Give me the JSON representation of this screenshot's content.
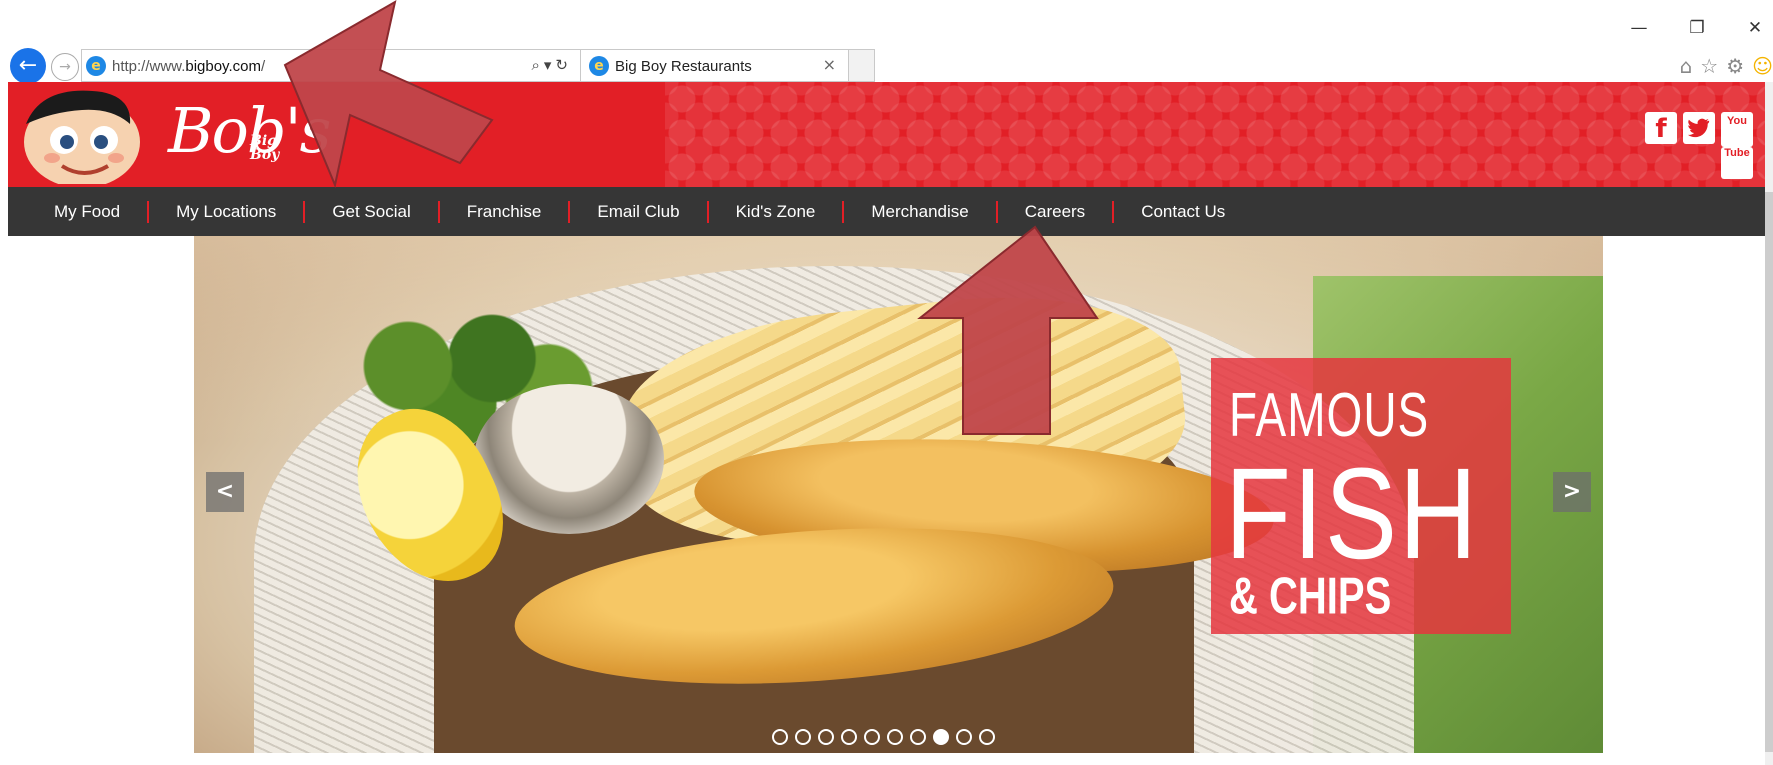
{
  "browser": {
    "window_controls": {
      "minimize": "—",
      "restore": "❐",
      "close": "✕"
    },
    "back_icon": "back-arrow-icon",
    "forward_icon": "forward-arrow-icon",
    "address": {
      "prefix": "http://www.",
      "domain": "bigboy.com",
      "suffix": "/"
    },
    "tab": {
      "title": "Big Boy Restaurants",
      "close": "×"
    },
    "toolbar_icons": [
      "home-icon",
      "favorites-star-icon",
      "settings-gear-icon",
      "smiley-feedback-icon"
    ]
  },
  "header": {
    "logo_main": "Bob's",
    "logo_sub_1": "Big",
    "logo_sub_2": "Boy",
    "social": {
      "facebook": "f",
      "twitter": "t",
      "youtube_1": "You",
      "youtube_2": "Tube"
    }
  },
  "nav": {
    "items": [
      "My Food",
      "My Locations",
      "Get Social",
      "Franchise",
      "Email Club",
      "Kid's Zone",
      "Merchandise",
      "Careers",
      "Contact Us"
    ]
  },
  "hero": {
    "promo_line1": "FAMOUS",
    "promo_line2": "FISH",
    "promo_line3": "& CHIPS",
    "prev_label": "<",
    "next_label": ">",
    "slides_total": 10,
    "active_slide": 8
  },
  "colors": {
    "brand_red": "#e21f26",
    "nav_bg": "#363636",
    "annotation_arrow": "#c0464a"
  }
}
